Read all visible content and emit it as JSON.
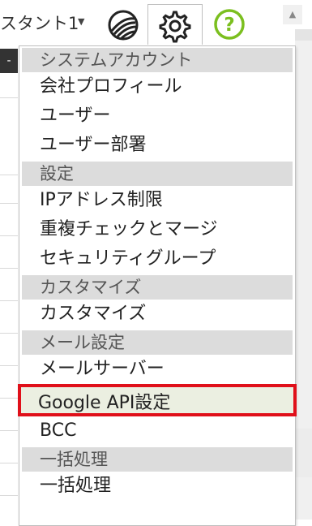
{
  "header": {
    "user_label": "スタント1",
    "caret": "▼",
    "scroll_up": "▲"
  },
  "background": {
    "dark_tab": "-"
  },
  "menu": {
    "sections": [
      {
        "header": "システムアカウント",
        "items": [
          "会社プロフィール",
          "ユーザー",
          "ユーザー部署"
        ]
      },
      {
        "header": "設定",
        "items": [
          "IPアドレス制限",
          "重複チェックとマージ",
          "セキュリティグループ"
        ]
      },
      {
        "header": "カスタマイズ",
        "items": [
          "カスタマイズ"
        ]
      },
      {
        "header": "メール設定",
        "items": [
          "メールサーバー",
          "Google API設定",
          "BCC"
        ]
      },
      {
        "header": "一括処理",
        "items": [
          "一括処理"
        ]
      }
    ],
    "highlighted_item": "Google API設定"
  },
  "colors": {
    "highlight_border": "#e0101a",
    "help_green": "#7bbf1f",
    "section_bg": "#dcdcdc"
  },
  "icons": [
    "globe-icon",
    "gear-icon",
    "help-icon",
    "caret-down-icon"
  ]
}
